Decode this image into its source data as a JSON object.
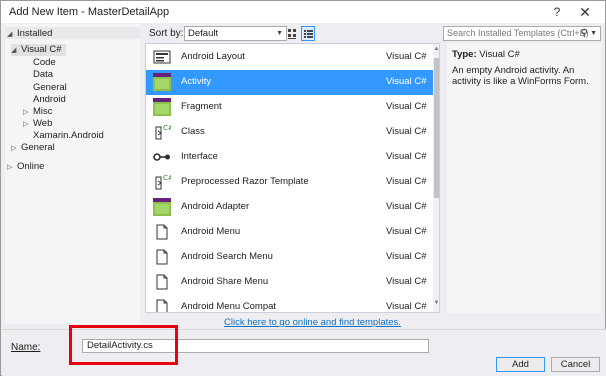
{
  "window": {
    "title": "Add New Item - MasterDetailApp",
    "help_glyph": "?",
    "close_glyph": "✕"
  },
  "tree": {
    "installed": "Installed",
    "visual_csharp": "Visual C#",
    "children": [
      "Code",
      "Data",
      "General",
      "Android",
      "Misc",
      "Web",
      "Xamarin.Android"
    ],
    "general": "General",
    "online": "Online"
  },
  "toolbar": {
    "sort_label": "Sort by:",
    "sort_value": "Default"
  },
  "search": {
    "placeholder": "Search Installed Templates (Ctrl+E)"
  },
  "templates": [
    {
      "name": "Android Layout",
      "lang": "Visual C#",
      "icon": "android-layout-icon"
    },
    {
      "name": "Activity",
      "lang": "Visual C#",
      "icon": "activity-icon"
    },
    {
      "name": "Fragment",
      "lang": "Visual C#",
      "icon": "fragment-icon"
    },
    {
      "name": "Class",
      "lang": "Visual C#",
      "icon": "class-icon"
    },
    {
      "name": "Interface",
      "lang": "Visual C#",
      "icon": "interface-icon"
    },
    {
      "name": "Preprocessed Razor Template",
      "lang": "Visual C#",
      "icon": "razor-template-icon"
    },
    {
      "name": "Android Adapter",
      "lang": "Visual C#",
      "icon": "android-adapter-icon"
    },
    {
      "name": "Android Menu",
      "lang": "Visual C#",
      "icon": "menu-icon"
    },
    {
      "name": "Android Search Menu",
      "lang": "Visual C#",
      "icon": "search-menu-icon"
    },
    {
      "name": "Android Share Menu",
      "lang": "Visual C#",
      "icon": "share-menu-icon"
    },
    {
      "name": "Android Menu Compat",
      "lang": "Visual C#",
      "icon": "menu-compat-icon"
    }
  ],
  "description": {
    "type_label": "Type:",
    "type_value": "Visual C#",
    "text": "An empty Android activity. An activity is like a WinForms Form."
  },
  "online_link": "Click here to go online and find templates.",
  "name_field": {
    "label": "Name:",
    "value": "DetailActivity.cs"
  },
  "buttons": {
    "add": "Add",
    "cancel": "Cancel"
  },
  "colors": {
    "selection": "#3399ff",
    "highlight_box": "#e8000c",
    "link": "#0e70c0"
  }
}
